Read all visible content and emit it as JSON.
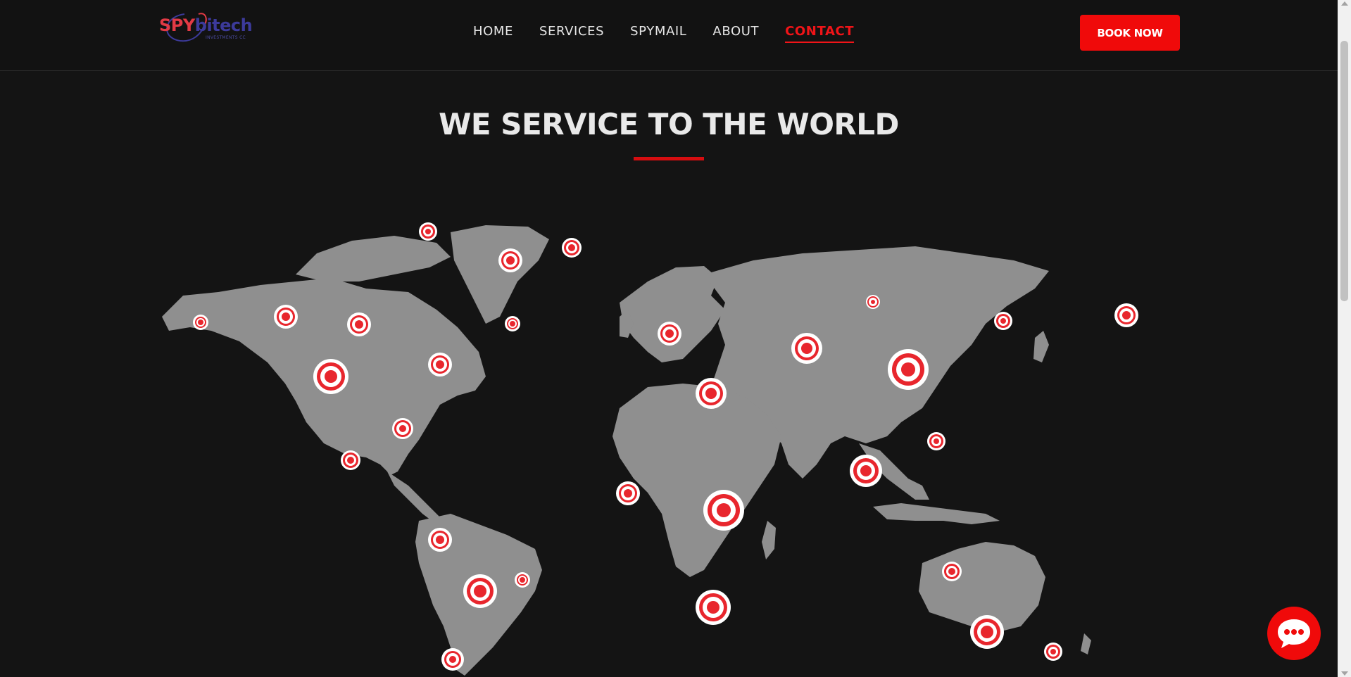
{
  "brand": {
    "logo_primary": "SPY",
    "logo_secondary": "bitech",
    "logo_tagline": "INVESTMENTS CC",
    "colors": {
      "primary": "#e23a45",
      "secondary": "#3c3a9a"
    }
  },
  "nav": {
    "items": [
      {
        "label": "HOME",
        "active": false
      },
      {
        "label": "SERVICES",
        "active": false
      },
      {
        "label": "SPYMAIL",
        "active": false
      },
      {
        "label": "ABOUT",
        "active": false
      },
      {
        "label": "CONTACT",
        "active": true
      }
    ],
    "book_label": "BOOK NOW"
  },
  "section": {
    "title": "WE SERVICE TO THE WORLD"
  },
  "map": {
    "land_color": "#8f8f8f",
    "marker_color": "#e8262d",
    "marker_ring_color": "#ffffff"
  },
  "colors": {
    "background": "#141414",
    "accent": "#f00a0a"
  },
  "icons": {
    "chat": "chat-bubble-icon",
    "scroll_up": "arrow-up-icon",
    "scroll_down": "arrow-down-icon"
  }
}
